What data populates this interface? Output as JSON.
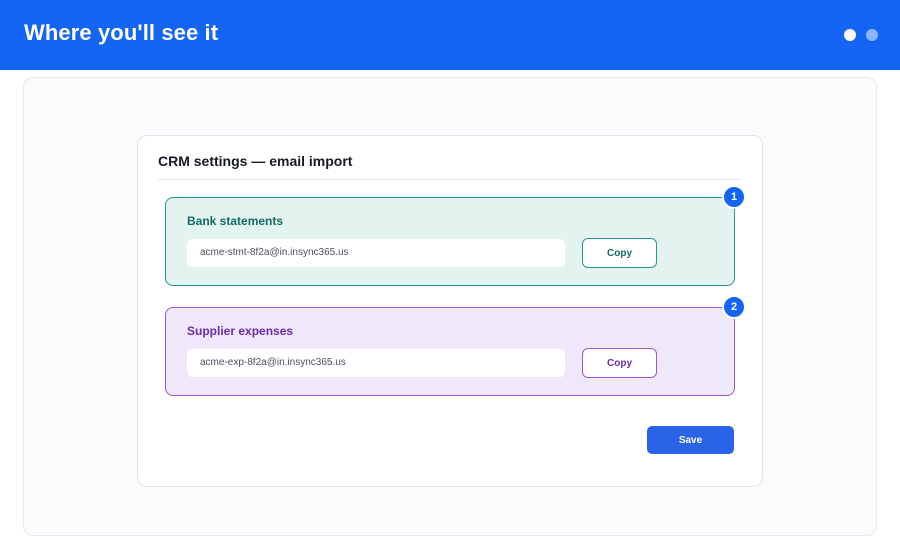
{
  "header": {
    "title": "Where you'll see it",
    "pager_dots": [
      {
        "state": "active",
        "color": "#ffffff"
      },
      {
        "state": "inactive",
        "color": "#8db4ff"
      }
    ],
    "background_color": "#1565f5"
  },
  "card": {
    "title": "CRM settings — email import"
  },
  "sections": [
    {
      "step": "1",
      "label": "Bank statements",
      "email": "acme-stmt-8f2a@in.insync365.us",
      "copy_label": "Copy",
      "accent_color": "#24998a",
      "background_color": "#e3f3f0"
    },
    {
      "step": "2",
      "label": "Supplier expenses",
      "email": "acme-exp-8f2a@in.insync365.us",
      "copy_label": "Copy",
      "accent_color": "#9b57d3",
      "background_color": "#efe8fb"
    }
  ],
  "actions": {
    "save_label": "Save",
    "save_color": "#2a63e8"
  },
  "icons": {
    "step_badge": "numbered-circle-icon"
  }
}
